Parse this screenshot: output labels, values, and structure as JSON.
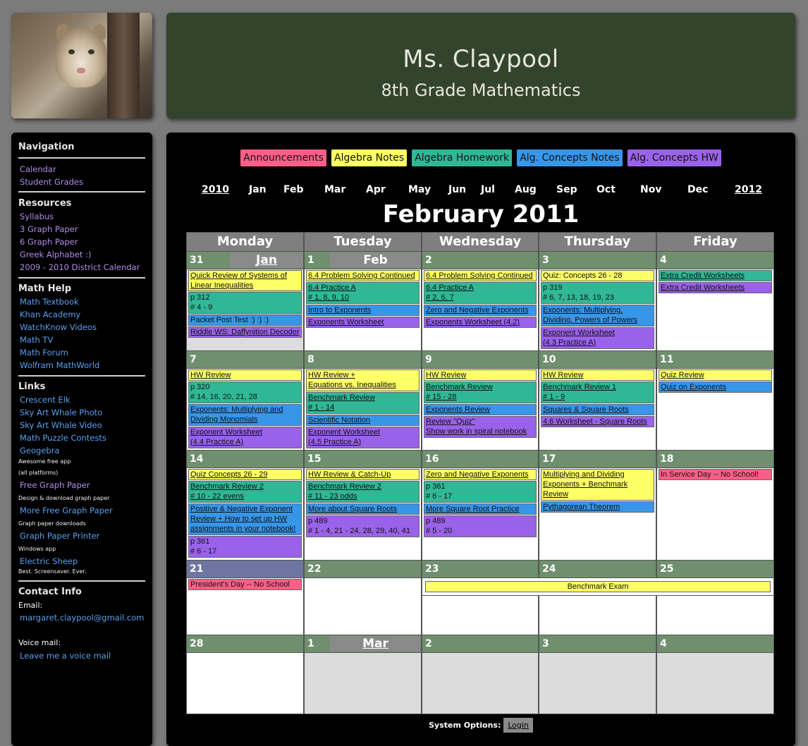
{
  "header": {
    "title": "Ms. Claypool",
    "subtitle": "8th Grade Mathematics"
  },
  "sidebar": {
    "nav_heading": "Navigation",
    "nav": [
      "Calendar",
      "Student Grades"
    ],
    "resources_heading": "Resources",
    "resources": [
      "Syllabus",
      "3 Graph Paper",
      "6 Graph Paper",
      "Greek Alphabet :)",
      "2009 - 2010 District Calendar"
    ],
    "mathhelp_heading": "Math Help",
    "mathhelp": [
      "Math Textbook",
      "Khan Academy",
      "WatchKnow Videos",
      "Math TV",
      "Math Forum",
      "Wolfram MathWorld"
    ],
    "links_heading": "Links",
    "links": [
      "Crescent Elk",
      "Sky Art Whale Photo",
      "Sky Art Whale Video",
      "Math Puzzle Contests",
      "Geogebra",
      "Free Graph Paper",
      "More Free Graph Paper",
      "Graph Paper Printer",
      "Electric Sheep"
    ],
    "link_notes": [
      "Awesome free app",
      "(all platforms)",
      "Design & download graph paper",
      "Graph paper downloads",
      "Windows app",
      "Best. Screensaver. Ever."
    ],
    "contact_heading": "Contact Info",
    "email_label": "Email:",
    "email": "margaret.claypool@gmail.com",
    "voicemail_label": "Voice mail:",
    "voicemail_link": "Leave me a voice mail"
  },
  "legend": [
    {
      "label": "Announcements",
      "color": "#ff5f87"
    },
    {
      "label": "Algebra Notes",
      "color": "#ffff66"
    },
    {
      "label": "Algebra Homework",
      "color": "#30b896"
    },
    {
      "label": "Alg. Concepts Notes",
      "color": "#3896e8"
    },
    {
      "label": "Alg. Concepts HW",
      "color": "#9a62e8"
    }
  ],
  "months_nav": {
    "prev_year": "2010",
    "months": [
      "Jan",
      "Feb",
      "Mar",
      "Apr",
      "May",
      "Jun",
      "Jul",
      "Aug",
      "Sep",
      "Oct",
      "Nov",
      "Dec"
    ],
    "next_year": "2012"
  },
  "calendar_title": "February 2011",
  "day_headers": [
    "Monday",
    "Tuesday",
    "Wednesday",
    "Thursday",
    "Friday"
  ],
  "month_labels": {
    "jan": "Jan",
    "feb": "Feb",
    "mar": "Mar"
  },
  "dates": [
    [
      "31",
      "1",
      "2",
      "3",
      "4"
    ],
    [
      "7",
      "8",
      "9",
      "10",
      "11"
    ],
    [
      "14",
      "15",
      "16",
      "17",
      "18"
    ],
    [
      "21",
      "22",
      "23",
      "24",
      "25"
    ],
    [
      "28",
      "1",
      "2",
      "3",
      "4"
    ]
  ],
  "events": {
    "w0": {
      "mon": [
        "Quick Review of Systems of Linear Inequalities",
        "p 312\n# 4 - 9",
        "Packet Post Test :) :) :)",
        "Riddle WS: Daffynition Decoder"
      ],
      "tue": [
        "6.4 Problem Solving Continued",
        "6.4 Practice A",
        "# 1, 8, 9, 10",
        "Intro to Exponents",
        "Exponents Worksheet"
      ],
      "wed": [
        "6.4 Problem Solving Continued",
        "6.4 Practice A",
        "# 2, 6, 7",
        "Zero and Negative Exponents",
        "Exponents Worksheet (4.2)"
      ],
      "thu": [
        "Quiz: Concepts 26 - 28",
        "p 319\n# 6, 7, 13, 18, 19, 23",
        "Exponents: Multiplying, Dividing, Powers of Powers",
        "Exponent Worksheet\n(4.3 Practice A)"
      ],
      "fri": [
        "Extra Credit Worksheets",
        "Extra Credit Worksheets"
      ]
    },
    "w1": {
      "mon": [
        "HW Review",
        "p 320\n# 14, 16, 20, 21, 28",
        "Exponents: Multiplying and Dividing Monomials",
        "Exponent Worksheet\n(4.4 Practice A)"
      ],
      "tue": [
        "HW Review +\nEquations vs. Inequalities",
        "Benchmark Review\n# 1 - 14",
        "Scientific Notation",
        "Exponent Worksheet\n(4.5 Practice A)"
      ],
      "wed": [
        "HW Review",
        "Benchmark Review\n# 15 - 28",
        "Exponents Review",
        "Review \"Quiz\"\nShow work in spiral notebook"
      ],
      "thu": [
        "HW Review",
        "Benchmark Review 1\n# 1 - 9",
        "Squares & Square Roots",
        "4.6 Worksheet - Square Roots"
      ],
      "fri": [
        "Quiz Review",
        "Quiz on Exponents"
      ]
    },
    "w2": {
      "mon": [
        "Quiz Concepts 26 - 29",
        "Benchmark Review 2\n# 10 - 22 evens",
        "Positive & Negative Exponent Review + How to set up HW assignments in your notebook!",
        "p 361\n# 6 - 17"
      ],
      "tue": [
        "HW Review & Catch-Up",
        "Benchmark Review 2\n# 11 - 23 odds",
        "More about Square Roots",
        "p 489\n# 1 - 4, 21 - 24, 28, 29, 40, 41"
      ],
      "wed": [
        "Zero and Negative Exponents",
        "p 361\n# 6 - 17",
        "More Square Root Practice",
        "p 489\n# 5 - 20"
      ],
      "thu": [
        "Multiplying and Dividing Exponents + Benchmark Review",
        "Pythagorean Theorem"
      ],
      "fri": [
        "In Service Day -- No School!"
      ]
    },
    "w3": {
      "mon": [
        "President's Day -- No School"
      ],
      "span": "Benchmark Exam"
    }
  },
  "system_options": {
    "label": "System Options:",
    "login": "Login"
  }
}
